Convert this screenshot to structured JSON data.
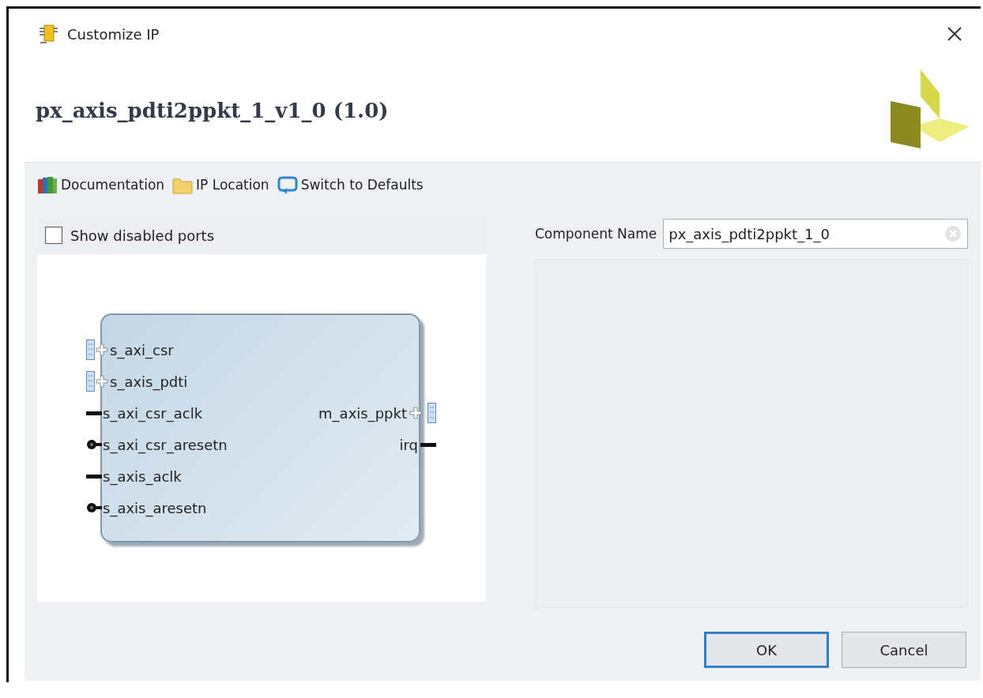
{
  "window": {
    "title": "Customize IP"
  },
  "header": {
    "title": "px_axis_pdti2ppkt_1_v1_0 (1.0)"
  },
  "toolbar": [
    {
      "label": "Documentation",
      "kind": "docs"
    },
    {
      "label": "IP Location",
      "kind": "folder"
    },
    {
      "label": "Switch to Defaults",
      "kind": "reset"
    }
  ],
  "symbol_panel": {
    "show_disabled_ports": {
      "label": "Show disabled ports",
      "checked": false
    },
    "block": {
      "left_ports": [
        {
          "name": "s_axi_csr",
          "kind": "bus"
        },
        {
          "name": "s_axis_pdti",
          "kind": "bus"
        },
        {
          "name": "s_axi_csr_aclk",
          "kind": "clock"
        },
        {
          "name": "s_axi_csr_aresetn",
          "kind": "reset"
        },
        {
          "name": "s_axis_aclk",
          "kind": "clock"
        },
        {
          "name": "s_axis_aresetn",
          "kind": "reset"
        }
      ],
      "right_ports": [
        {
          "name": "m_axis_ppkt",
          "kind": "bus"
        },
        {
          "name": "irq",
          "kind": "clock"
        }
      ]
    }
  },
  "component_name": {
    "label": "Component Name",
    "value": "px_axis_pdti2ppkt_1_0"
  },
  "buttons": [
    {
      "label": "OK",
      "default": true
    },
    {
      "label": "Cancel",
      "default": false
    }
  ]
}
